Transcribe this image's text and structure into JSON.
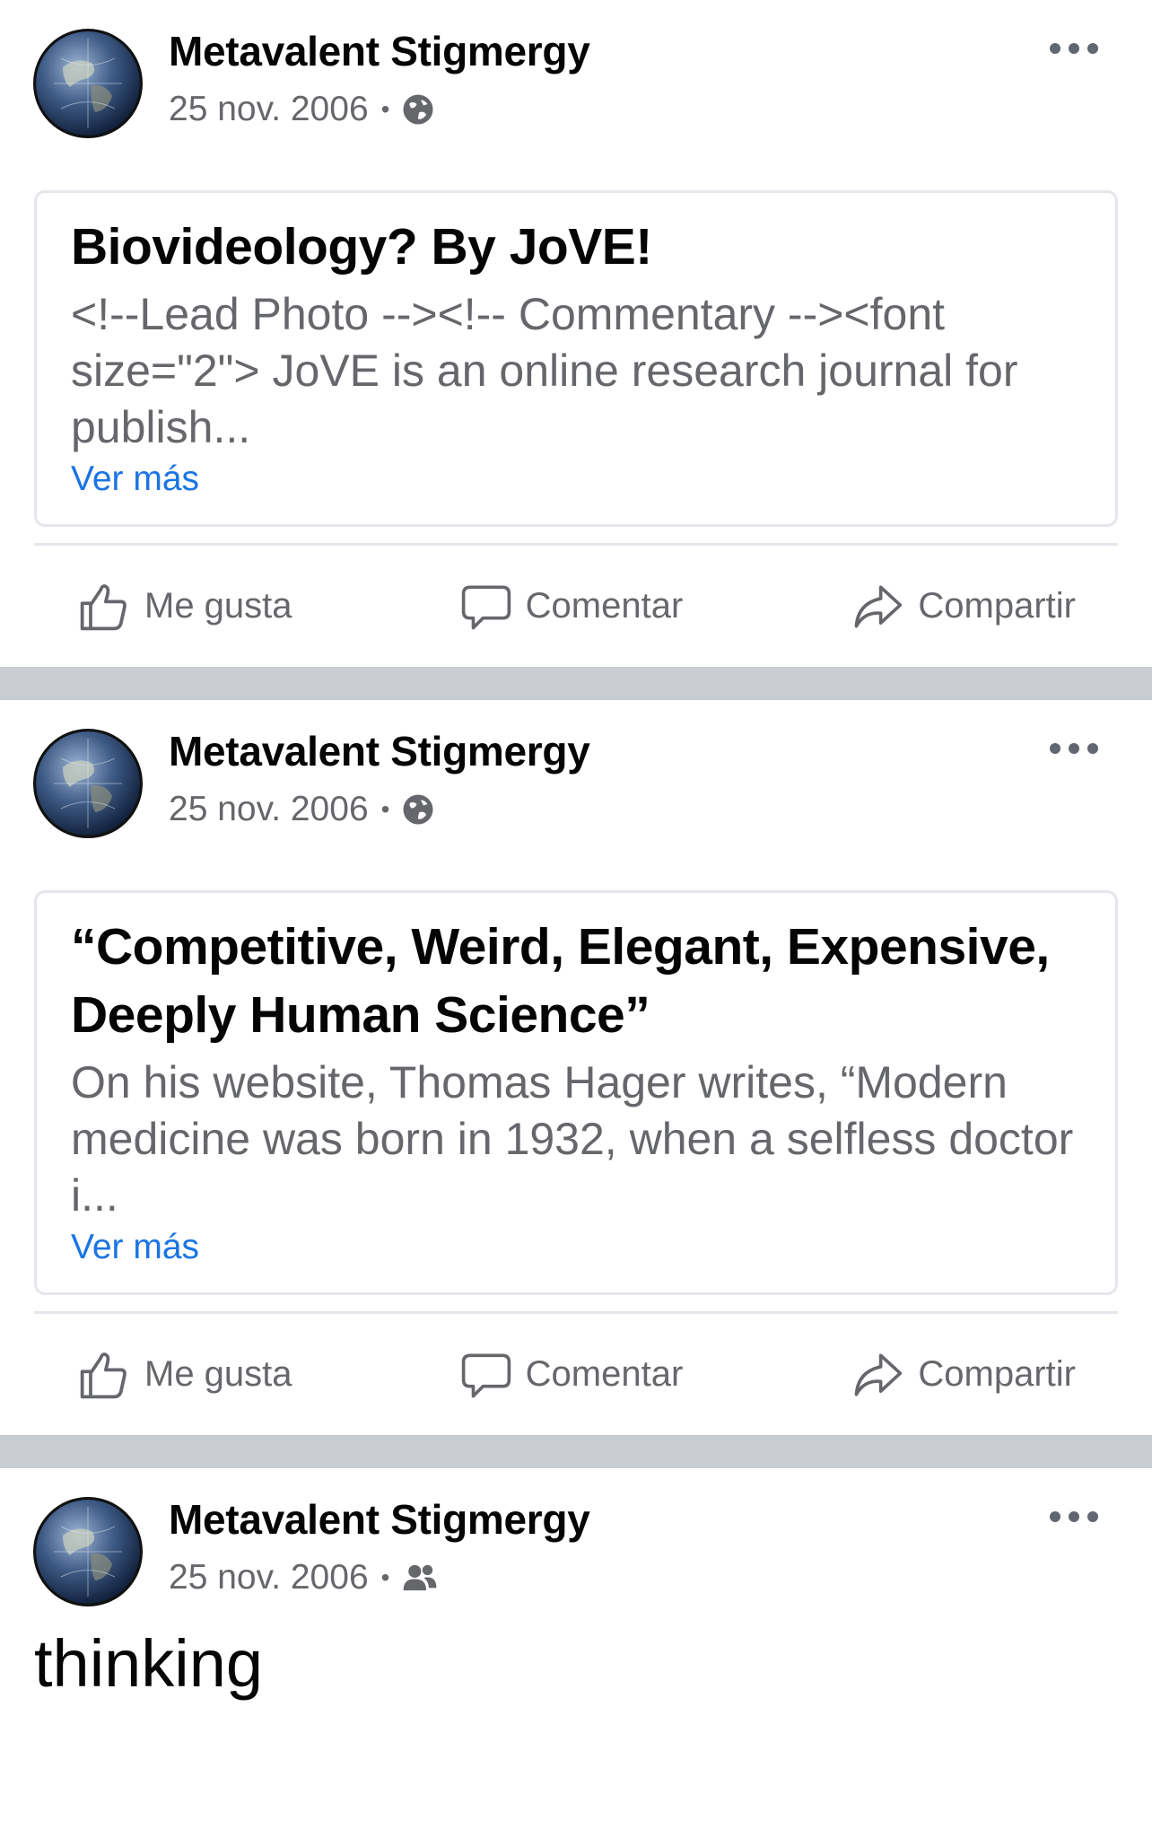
{
  "posts": [
    {
      "author": "Metavalent Stigmergy",
      "date": "25 nov. 2006",
      "audience_icon": "globe-icon",
      "link": {
        "title": "Biovideology? By JoVE!",
        "description": "<!--Lead Photo --><!-- Commentary --><font size=\"2\"> JoVE  is an online research journal for publish...",
        "see_more": "Ver más"
      },
      "actions": {
        "like": "Me gusta",
        "comment": "Comentar",
        "share": "Compartir"
      }
    },
    {
      "author": "Metavalent Stigmergy",
      "date": "25 nov. 2006",
      "audience_icon": "globe-icon",
      "link": {
        "title": "“Competitive, Weird, Elegant, Expensive, Deeply Human Science”",
        "description": "On his website,  Thomas Hager  writes, “Modern medicine was born in 1932, when a selfless doctor i...",
        "see_more": "Ver más"
      },
      "actions": {
        "like": "Me gusta",
        "comment": "Comentar",
        "share": "Compartir"
      }
    },
    {
      "author": "Metavalent Stigmergy",
      "date": "25 nov. 2006",
      "audience_icon": "friends-icon",
      "text": "thinking"
    }
  ],
  "colors": {
    "link": "#1b74e4",
    "secondary_text": "#65676b",
    "separator": "#c9ccd1"
  }
}
